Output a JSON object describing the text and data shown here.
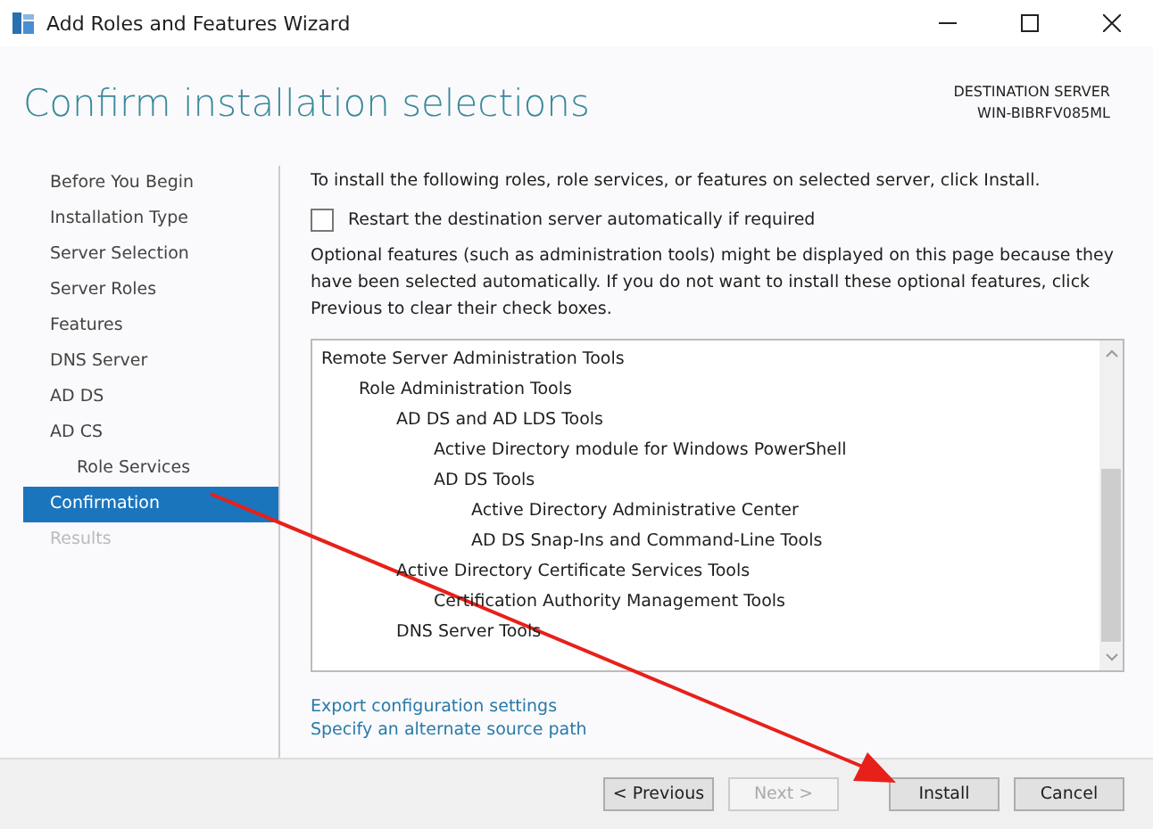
{
  "window": {
    "title": "Add Roles and Features Wizard"
  },
  "header": {
    "title": "Confirm installation selections",
    "destination_label": "DESTINATION SERVER",
    "destination_server": "WIN-BIBRFV085ML"
  },
  "sidebar": {
    "items": [
      {
        "label": "Before You Begin",
        "selected": false,
        "disabled": false,
        "sub": false
      },
      {
        "label": "Installation Type",
        "selected": false,
        "disabled": false,
        "sub": false
      },
      {
        "label": "Server Selection",
        "selected": false,
        "disabled": false,
        "sub": false
      },
      {
        "label": "Server Roles",
        "selected": false,
        "disabled": false,
        "sub": false
      },
      {
        "label": "Features",
        "selected": false,
        "disabled": false,
        "sub": false
      },
      {
        "label": "DNS Server",
        "selected": false,
        "disabled": false,
        "sub": false
      },
      {
        "label": "AD DS",
        "selected": false,
        "disabled": false,
        "sub": false
      },
      {
        "label": "AD CS",
        "selected": false,
        "disabled": false,
        "sub": false
      },
      {
        "label": "Role Services",
        "selected": false,
        "disabled": false,
        "sub": true
      },
      {
        "label": "Confirmation",
        "selected": true,
        "disabled": false,
        "sub": false
      },
      {
        "label": "Results",
        "selected": false,
        "disabled": true,
        "sub": false
      }
    ]
  },
  "intro": "To install the following roles, role services, or features on selected server, click Install.",
  "restart_option": {
    "label": "Restart the destination server automatically if required",
    "checked": false
  },
  "note": "Optional features (such as administration tools) might be displayed on this page because they have been selected automatically. If you do not want to install these optional features, click Previous to clear their check boxes.",
  "features": [
    {
      "label": "Remote Server Administration Tools",
      "children": [
        {
          "label": "Role Administration Tools",
          "children": [
            {
              "label": "AD DS and AD LDS Tools",
              "children": [
                {
                  "label": "Active Directory module for Windows PowerShell"
                },
                {
                  "label": "AD DS Tools",
                  "children": [
                    {
                      "label": "Active Directory Administrative Center"
                    },
                    {
                      "label": "AD DS Snap-Ins and Command-Line Tools"
                    }
                  ]
                }
              ]
            },
            {
              "label": "Active Directory Certificate Services Tools",
              "children": [
                {
                  "label": "Certification Authority Management Tools"
                }
              ]
            },
            {
              "label": "DNS Server Tools"
            }
          ]
        }
      ]
    }
  ],
  "links": [
    "Export configuration settings",
    "Specify an alternate source path"
  ],
  "buttons": [
    {
      "label": "< Previous",
      "disabled": false
    },
    {
      "label": "Next >",
      "disabled": true
    },
    {
      "label": "Install",
      "disabled": false
    },
    {
      "label": "Cancel",
      "disabled": false
    }
  ]
}
